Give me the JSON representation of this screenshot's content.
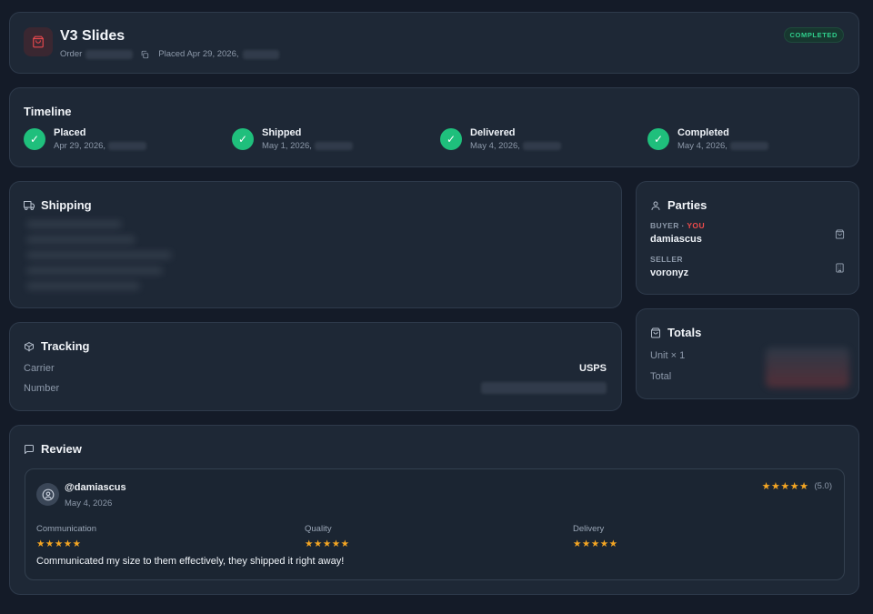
{
  "header": {
    "title": "V3 Slides",
    "order_label": "Order",
    "placed_text": "Placed Apr 29, 2026,",
    "status": "COMPLETED",
    "icon": "shopping-bag-icon"
  },
  "timeline": {
    "title": "Timeline",
    "steps": [
      {
        "label": "Placed",
        "date": "Apr 29, 2026,"
      },
      {
        "label": "Shipped",
        "date": "May 1, 2026,"
      },
      {
        "label": "Delivered",
        "date": "May 4, 2026,"
      },
      {
        "label": "Completed",
        "date": "May 4, 2026,"
      }
    ]
  },
  "shipping": {
    "title": "Shipping",
    "icon": "truck-icon"
  },
  "tracking": {
    "title": "Tracking",
    "icon": "package-icon",
    "carrier_label": "Carrier",
    "carrier_value": "USPS",
    "number_label": "Number"
  },
  "parties": {
    "title": "Parties",
    "icon": "user-icon",
    "buyer_role": "BUYER ·",
    "buyer_tag": "YOU",
    "buyer_name": "damiascus",
    "seller_role": "SELLER",
    "seller_name": "voronyz"
  },
  "totals": {
    "title": "Totals",
    "icon": "bag-icon",
    "unit_label": "Unit × 1",
    "total_label": "Total"
  },
  "review": {
    "title": "Review",
    "icon": "message-icon",
    "reviewer": "@damiascus",
    "date": "May 4, 2026",
    "overall_stars": "★★★★★",
    "overall_score": "(5.0)",
    "communication_label": "Communication",
    "communication_stars": "★★★★★",
    "quality_label": "Quality",
    "quality_stars": "★★★★★",
    "delivery_label": "Delivery",
    "delivery_stars": "★★★★★",
    "text": "Communicated my size to them effectively, they shipped it right away!"
  },
  "colors": {
    "background": "#141b28",
    "card": "#1e2836",
    "success": "#1fbf7c",
    "accent_red": "#ef4b4b",
    "star": "#f5a623"
  }
}
